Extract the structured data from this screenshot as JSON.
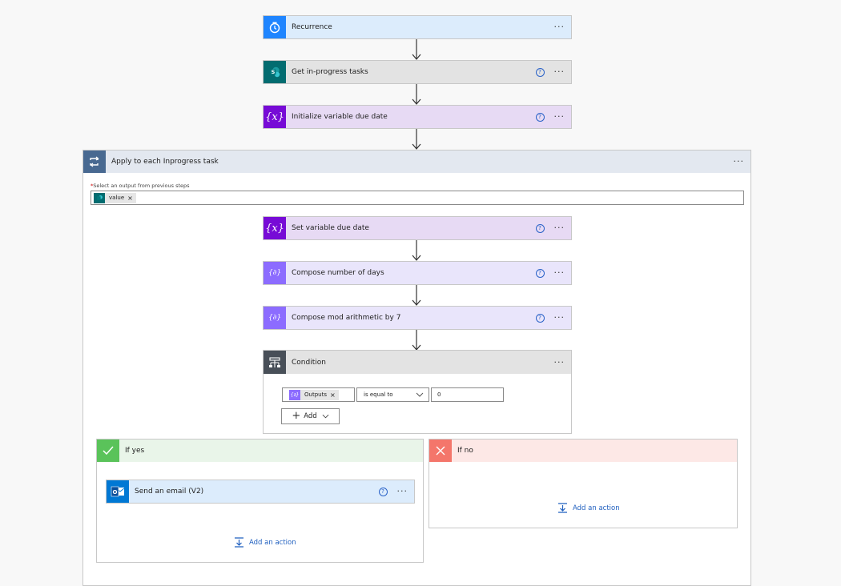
{
  "steps": {
    "recurrence": "Recurrence",
    "get_tasks": "Get in-progress tasks",
    "init_var": "Initialize variable due date",
    "apply_each": "Apply to each Inprogress task",
    "set_var": "Set variable due date",
    "compose_days": "Compose number of days",
    "compose_mod": "Compose mod arithmetic by 7",
    "condition": "Condition"
  },
  "apply_each": {
    "select_label": "Select an output from previous steps",
    "required_mark": "*",
    "token": "value"
  },
  "condition": {
    "left_token": "Outputs",
    "operator": "is equal to",
    "right_value": "0",
    "add_label": "Add"
  },
  "branches": {
    "yes_title": "If yes",
    "no_title": "If no",
    "send_email": "Send an email (V2)",
    "add_action": "Add an action"
  },
  "icons": {
    "help": "?",
    "more": "···",
    "remove": "×"
  },
  "colors": {
    "recurrence": "#1f85ff",
    "sharepoint": "#036c70",
    "variable": "#770bd6",
    "compose": "#8c6cff",
    "condition": "#484f58",
    "loop": "#486991",
    "outlook": "#0078d4",
    "yes": "#5ac35a",
    "no": "#f4766b",
    "link": "#1f5fbf"
  }
}
